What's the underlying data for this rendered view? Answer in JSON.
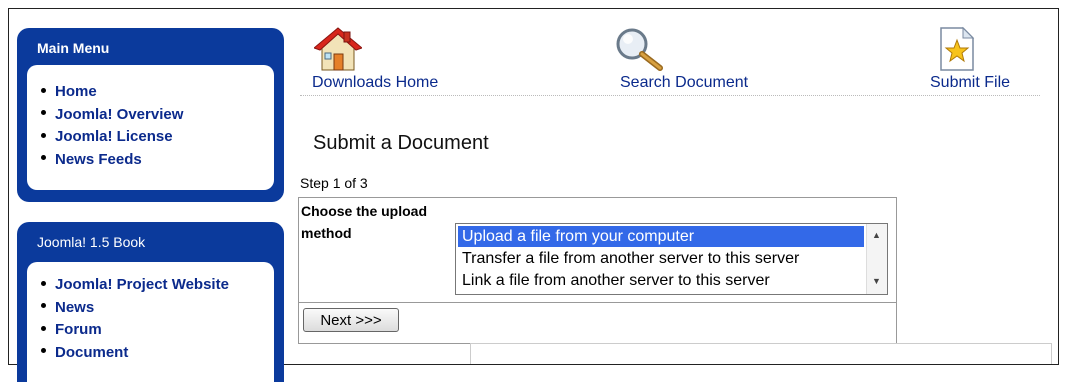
{
  "sidebar": {
    "main_menu": {
      "title": "Main Menu",
      "items": [
        {
          "label": "Home"
        },
        {
          "label": "Joomla! Overview"
        },
        {
          "label": "Joomla! License"
        },
        {
          "label": "News Feeds"
        }
      ]
    },
    "book_menu": {
      "title": "Joomla! 1.5 Book",
      "items": [
        {
          "label": "Joomla! Project Website"
        },
        {
          "label": "News"
        },
        {
          "label": "Forum"
        },
        {
          "label": "Document"
        }
      ]
    }
  },
  "nav": {
    "downloads_home": {
      "label": "Downloads Home",
      "icon": "house-icon"
    },
    "search_document": {
      "label": "Search Document",
      "icon": "magnifier-icon"
    },
    "submit_file": {
      "label": "Submit File",
      "icon": "star-document-icon"
    }
  },
  "page": {
    "title": "Submit a Document",
    "step": "Step 1 of 3"
  },
  "form": {
    "label": "Choose the upload method",
    "options": [
      {
        "label": "Upload a file from your computer",
        "selected": true
      },
      {
        "label": "Transfer a file from another server to this server",
        "selected": false
      },
      {
        "label": "Link a file from another server to this server",
        "selected": false
      }
    ],
    "next_label": "Next >>>"
  },
  "colors": {
    "module_bg": "#0b3a9c",
    "link": "#0b2a8c",
    "selection": "#3369e8"
  }
}
